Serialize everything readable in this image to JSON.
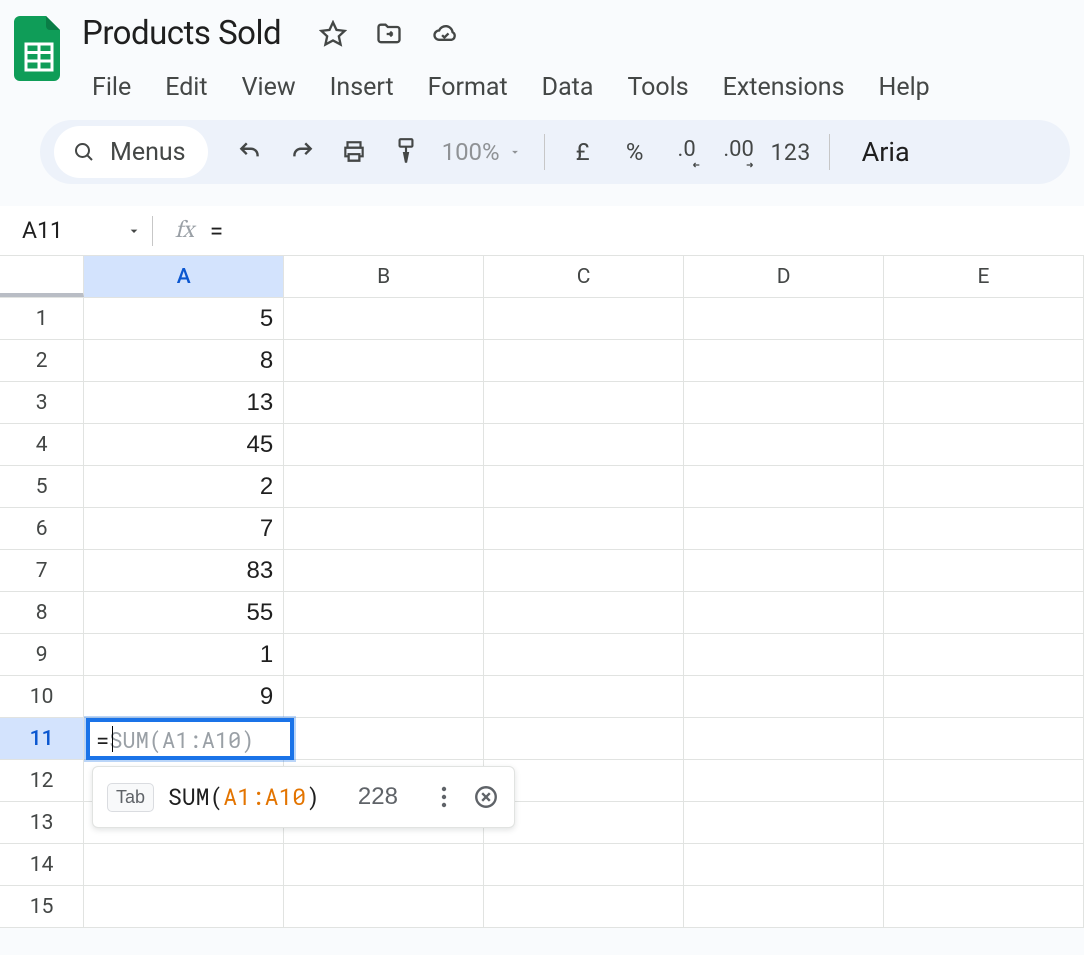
{
  "doc_title": "Products Sold",
  "menus": [
    "File",
    "Edit",
    "View",
    "Insert",
    "Format",
    "Data",
    "Tools",
    "Extensions",
    "Help"
  ],
  "toolbar": {
    "menus_label": "Menus",
    "zoom": "100%",
    "currency": "£",
    "percent": "%",
    "dec_dec": ".0",
    "inc_dec": ".00",
    "n123": "123",
    "font": "Aria"
  },
  "namebox": "A11",
  "formula": "=",
  "columns": [
    "A",
    "B",
    "C",
    "D",
    "E"
  ],
  "active_col": "A",
  "active_row": 11,
  "rows": [
    {
      "n": 1,
      "A": "5"
    },
    {
      "n": 2,
      "A": "8"
    },
    {
      "n": 3,
      "A": "13"
    },
    {
      "n": 4,
      "A": "45"
    },
    {
      "n": 5,
      "A": "2"
    },
    {
      "n": 6,
      "A": "7"
    },
    {
      "n": 7,
      "A": "83"
    },
    {
      "n": 8,
      "A": "55"
    },
    {
      "n": 9,
      "A": "1"
    },
    {
      "n": 10,
      "A": "9"
    },
    {
      "n": 11,
      "A": ""
    },
    {
      "n": 12,
      "A": ""
    },
    {
      "n": 13,
      "A": ""
    },
    {
      "n": 14,
      "A": ""
    },
    {
      "n": 15,
      "A": ""
    }
  ],
  "active_cell_editor": {
    "prefix": "=",
    "ghost": "SUM(A1:A10)"
  },
  "autocomplete": {
    "tab_label": "Tab",
    "func": "SUM(",
    "range": "A1:A10",
    "close": ")",
    "result": "228"
  }
}
